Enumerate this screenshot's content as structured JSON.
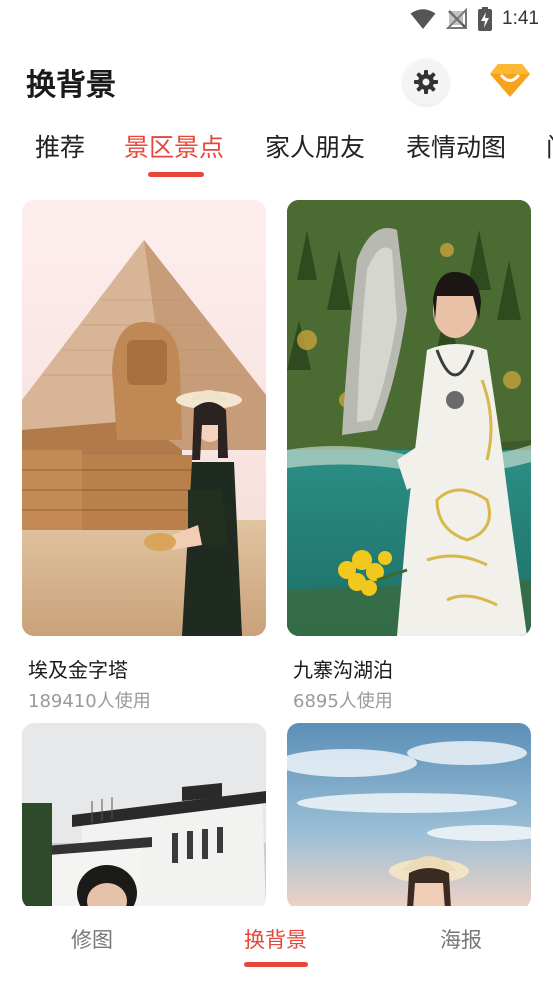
{
  "status_bar": {
    "time": "1:41",
    "icons": [
      "wifi-icon",
      "no-signal-icon",
      "battery-charging-icon"
    ]
  },
  "header": {
    "title": "换背景",
    "settings_icon": "gear-icon",
    "vip_icon": "vip-diamond-icon"
  },
  "tabs": [
    {
      "label": "推荐",
      "active": false
    },
    {
      "label": "景区景点",
      "active": true
    },
    {
      "label": "家人朋友",
      "active": false
    },
    {
      "label": "表情动图",
      "active": false
    },
    {
      "label": "门",
      "active": false
    }
  ],
  "cards": [
    {
      "title": "埃及金字塔",
      "usage": "189410人使用"
    },
    {
      "title": "九寨沟湖泊",
      "usage": "6895人使用"
    },
    {
      "title": "",
      "usage": ""
    },
    {
      "title": "",
      "usage": ""
    }
  ],
  "bottom_nav": [
    {
      "label": "修图",
      "active": false
    },
    {
      "label": "换背景",
      "active": true
    },
    {
      "label": "海报",
      "active": false
    }
  ],
  "colors": {
    "accent": "#e8463a",
    "vip": "#f7a21b"
  }
}
